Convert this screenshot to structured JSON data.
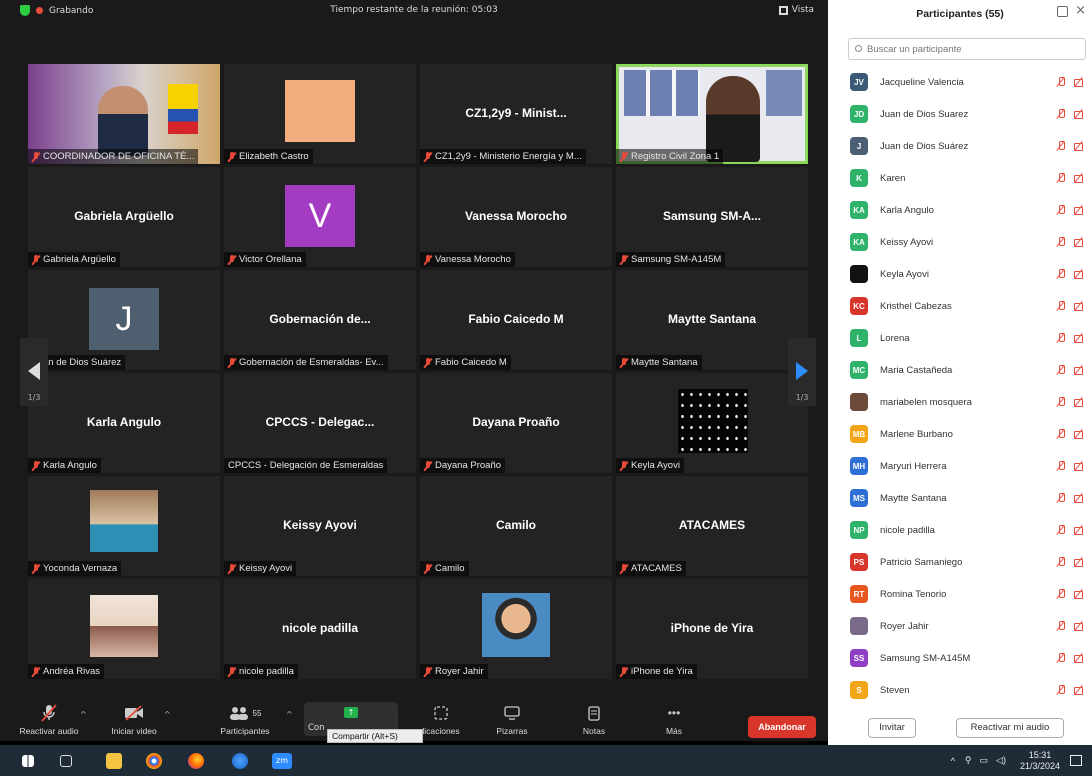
{
  "topbar": {
    "recording": "Grabando",
    "time_remaining": "Tiempo restante de la reunión: 05:03",
    "view": "Vista"
  },
  "tiles": [
    {
      "big": "",
      "label": "COORDINADOR DE OFICINA TÉ...",
      "kind": "photo-office"
    },
    {
      "big": "",
      "label": "Elizabeth Castro",
      "kind": "peach"
    },
    {
      "big": "CZ1,2y9 - Minist...",
      "label": "CZ1,2y9 - Ministerio Energía y M..."
    },
    {
      "big": "",
      "label": "Registro Civil Zona 1",
      "kind": "photo-registro"
    },
    {
      "big": "Gabriela Argüello",
      "label": "Gabriela Argüello"
    },
    {
      "big": "",
      "label": "Victor Orellana",
      "kind": "letter",
      "letter": "V"
    },
    {
      "big": "Vanessa Morocho",
      "label": "Vanessa Morocho"
    },
    {
      "big": "Samsung  SM-A...",
      "label": "Samsung SM-A145M"
    },
    {
      "big": "",
      "label": "an de Dios Suárez",
      "kind": "letter2",
      "letter": "J"
    },
    {
      "big": "Gobernación  de...",
      "label": "Gobernación de Esmeraldas- Ev..."
    },
    {
      "big": "Fabio Caicedo M",
      "label": "Fabio Caicedo M"
    },
    {
      "big": "Maytte Santana",
      "label": "Maytte Santana"
    },
    {
      "big": "Karla Angulo",
      "label": "Karla Angulo"
    },
    {
      "big": "CPCCS  - Delegac...",
      "label": "CPCCS - Delegación de Esmeraldas",
      "unmuted": true
    },
    {
      "big": "Dayana Proaño",
      "label": "Dayana Proaño"
    },
    {
      "big": "",
      "label": "Keyla Ayovi",
      "kind": "stars"
    },
    {
      "big": "",
      "label": "Yoconda Vernaza",
      "kind": "photo-yoconda"
    },
    {
      "big": "Keissy Ayovi",
      "label": "Keissy Ayovi"
    },
    {
      "big": "Camilo",
      "label": "Camilo"
    },
    {
      "big": "ATACAMES",
      "label": "ATACAMES"
    },
    {
      "big": "",
      "label": "Andréa Rivas",
      "kind": "photo-group"
    },
    {
      "big": "nicole padilla",
      "label": "nicole padilla"
    },
    {
      "big": "",
      "label": "Royer Jahir",
      "kind": "cartoon"
    },
    {
      "big": "iPhone de Yira",
      "label": "iPhone de Yira"
    }
  ],
  "nav": {
    "left_page": "1/3",
    "right_page": "1/3"
  },
  "toolbar": {
    "unmute": "Reactivar audio",
    "start_video": "Iniciar video",
    "participants": "Participantes",
    "participants_count": "55",
    "share_partial": "Con",
    "share_tooltip": "Compartir (Alt+S)",
    "apps": "licaciones",
    "whiteboards": "Pizarras",
    "notes": "Notas",
    "more": "Más",
    "leave": "Abandonar"
  },
  "panel": {
    "title": "Participantes (55)",
    "search_placeholder": "Buscar un participante",
    "participants": [
      {
        "initials": "JV",
        "name": "Jacqueline Valencia",
        "color": "#3a5a78"
      },
      {
        "initials": "JD",
        "name": "Juan de Dios Suarez",
        "color": "#2fb36b"
      },
      {
        "initials": "J",
        "name": "Juan de Dios Suárez",
        "color": "#4a5f73"
      },
      {
        "initials": "K",
        "name": "Karen",
        "color": "#2fb36b"
      },
      {
        "initials": "KA",
        "name": "Karla Angulo",
        "color": "#2fb36b"
      },
      {
        "initials": "KA",
        "name": "Keissy Ayovi",
        "color": "#2fb36b"
      },
      {
        "initials": "",
        "name": "Keyla Ayovi",
        "color": "#111111"
      },
      {
        "initials": "KC",
        "name": "Kristhel Cabezas",
        "color": "#d9362b"
      },
      {
        "initials": "L",
        "name": "Lorena",
        "color": "#2fb36b"
      },
      {
        "initials": "MC",
        "name": "Maria Castañeda",
        "color": "#2fb36b"
      },
      {
        "initials": "",
        "name": "mariabelen mosquera",
        "color": "#6b4a3a"
      },
      {
        "initials": "MB",
        "name": "Marlene Burbano",
        "color": "#f2a516"
      },
      {
        "initials": "MH",
        "name": "Maryuri Herrera",
        "color": "#2e6fd6"
      },
      {
        "initials": "MS",
        "name": "Maytte Santana",
        "color": "#2e6fd6"
      },
      {
        "initials": "NP",
        "name": "nicole padilla",
        "color": "#2fb36b"
      },
      {
        "initials": "PS",
        "name": "Patricio Samaniego",
        "color": "#d9362b"
      },
      {
        "initials": "RT",
        "name": "Romina Tenorio",
        "color": "#e8561f"
      },
      {
        "initials": "",
        "name": "Royer Jahir",
        "color": "#7a6a8a"
      },
      {
        "initials": "SS",
        "name": "Samsung SM-A145M",
        "color": "#8e3fc4"
      },
      {
        "initials": "S",
        "name": "Steven",
        "color": "#f2a516"
      }
    ],
    "invite": "Invitar",
    "unmute_me": "Reactivar mi audio"
  },
  "taskbar": {
    "time": "15:31",
    "date": "21/3/2024"
  }
}
